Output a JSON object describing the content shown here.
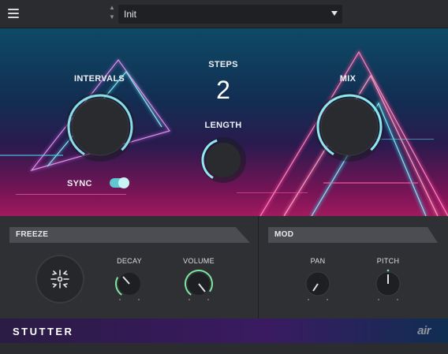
{
  "header": {
    "preset_name": "Init",
    "menu_icon": "hamburger-icon",
    "prev_icon": "▲",
    "next_icon": "▼"
  },
  "hero": {
    "intervals_label": "INTERVALS",
    "steps_label": "STEPS",
    "steps_value": "2",
    "length_label": "LENGTH",
    "mix_label": "MIX",
    "sync_label": "SYNC",
    "sync_on": true
  },
  "freeze_panel": {
    "title": "FREEZE",
    "decay_label": "DECAY",
    "volume_label": "VOLUME",
    "freeze_icon": "freeze-burst-icon"
  },
  "mod_panel": {
    "title": "MOD",
    "pan_label": "PAN",
    "pitch_label": "PITCH"
  },
  "footer": {
    "brand": "STUTTER",
    "logo": "air"
  },
  "colors": {
    "accent": "#8fe8ef",
    "ring_green": "#7de6a0",
    "hero_top": "#0e4a66",
    "hero_bottom": "#a01a5e"
  }
}
